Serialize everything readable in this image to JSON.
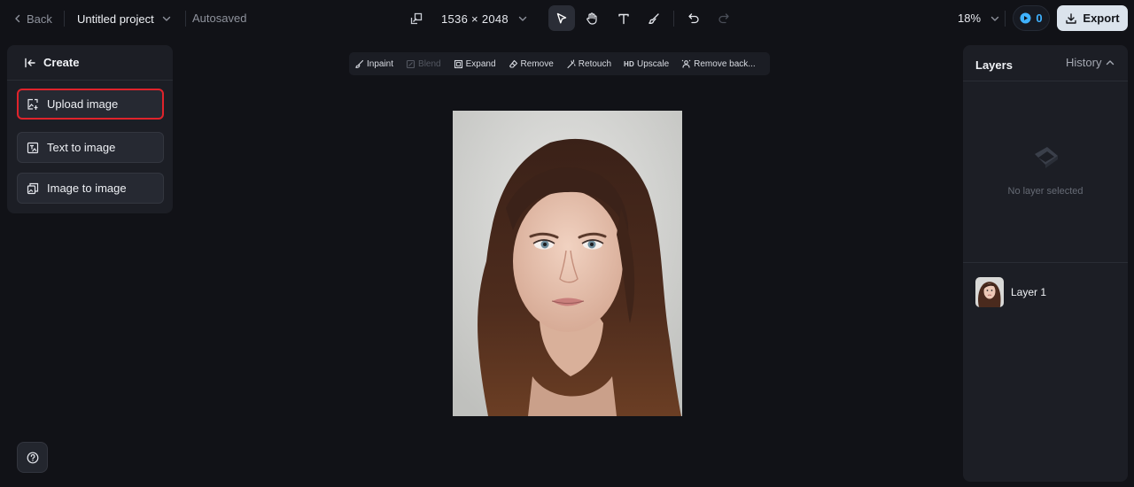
{
  "header": {
    "back_label": "Back",
    "project_title": "Untitled project",
    "autosave_status": "Autosaved",
    "canvas_size": "1536 × 2048",
    "zoom": "18%",
    "credits": "0",
    "export_label": "Export"
  },
  "create_panel": {
    "title": "Create",
    "items": [
      {
        "label": "Upload image"
      },
      {
        "label": "Text to image"
      },
      {
        "label": "Image to image"
      }
    ]
  },
  "edit_toolbar": {
    "inpaint": "Inpaint",
    "blend": "Blend",
    "expand": "Expand",
    "remove": "Remove",
    "retouch": "Retouch",
    "hd_badge": "HD",
    "upscale": "Upscale",
    "remove_background": "Remove back..."
  },
  "layers_panel": {
    "title": "Layers",
    "history_label": "History",
    "empty_text": "No layer selected",
    "layers": [
      {
        "name": "Layer 1"
      }
    ]
  },
  "colors": {
    "background": "#111217",
    "panel": "#1c1e25",
    "accent_blue": "#3fb2ff",
    "highlight_red": "#e0232b",
    "export_button": "#dbe3ec"
  },
  "icons": {
    "back": "chevron-left-icon",
    "project_menu": "chevron-down-icon",
    "resize": "resize-icon",
    "select_tool": "cursor-arrow-icon",
    "hand_tool": "hand-icon",
    "text_tool": "text-icon",
    "brush_tool": "brush-icon",
    "undo": "undo-icon",
    "redo": "redo-icon",
    "credits": "play-coin-icon",
    "export": "download-icon",
    "help": "help-icon"
  }
}
